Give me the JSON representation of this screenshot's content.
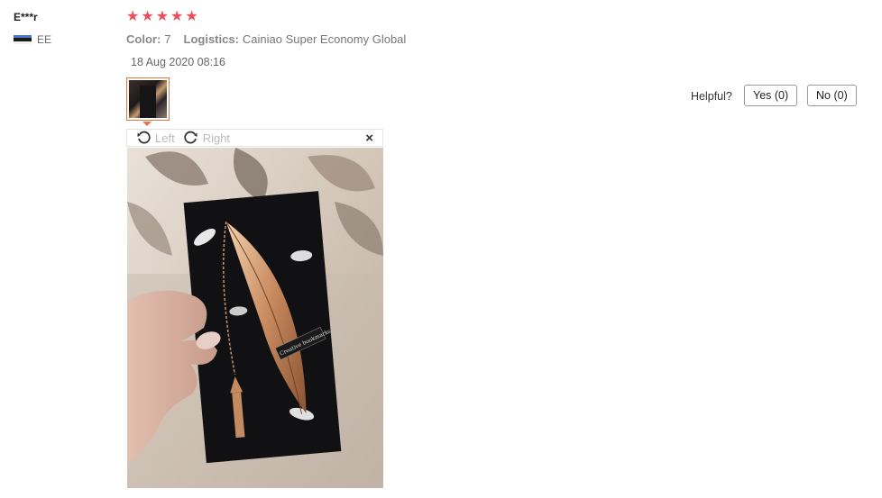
{
  "reviewer": {
    "name": "E***r",
    "country_code": "EE"
  },
  "rating": {
    "stars": 5,
    "max": 5
  },
  "meta": {
    "color_label": "Color:",
    "color_value": "7",
    "logistics_label": "Logistics:",
    "logistics_value": "Cainiao Super Economy Global"
  },
  "date": "18 Aug 2020 08:16",
  "feedback": {
    "helpful_label": "Helpful?",
    "yes_label": "Yes (0)",
    "no_label": "No (0)"
  },
  "viewer": {
    "rotate_left_label": "Left",
    "rotate_right_label": "Right",
    "close_glyph": "×",
    "photo_caption": "Creative bookmarks"
  },
  "colors": {
    "star": "#f04c5b",
    "thumb_border": "#e8773b"
  }
}
